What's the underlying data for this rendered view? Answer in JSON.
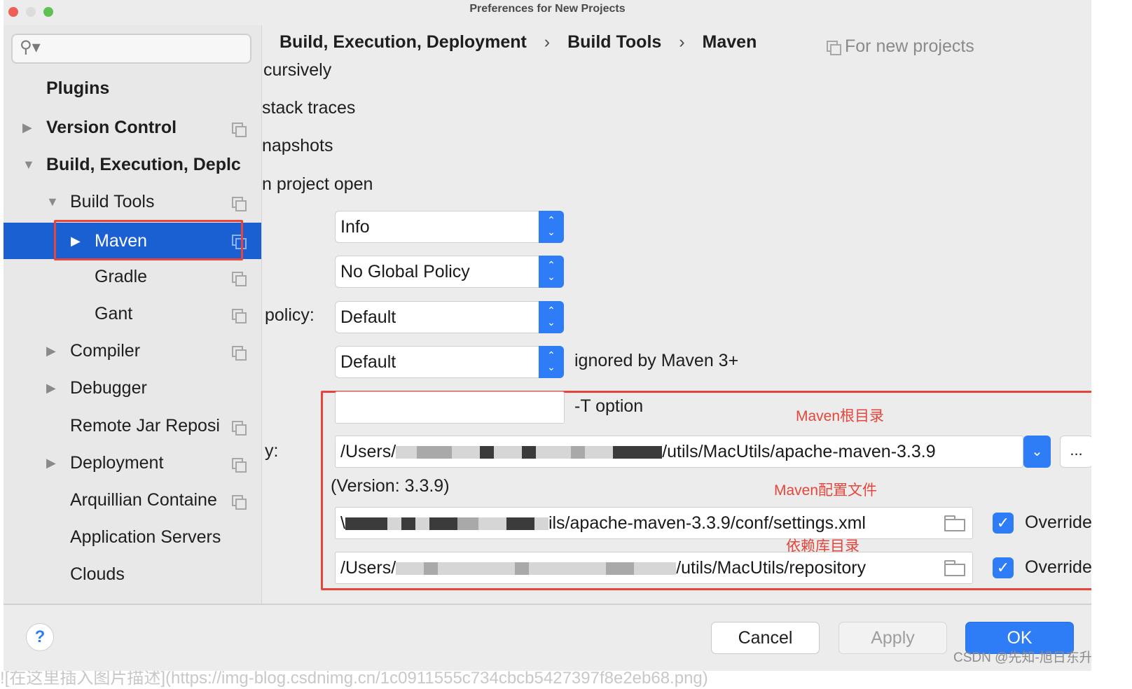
{
  "window": {
    "title": "Preferences for New Projects"
  },
  "search": {
    "placeholder": ""
  },
  "sidebar": {
    "items": [
      {
        "label": "Plugins"
      },
      {
        "label": "Version Control"
      },
      {
        "label": "Build, Execution, Deplc"
      },
      {
        "label": "Build Tools"
      },
      {
        "label": "Maven"
      },
      {
        "label": "Gradle"
      },
      {
        "label": "Gant"
      },
      {
        "label": "Compiler"
      },
      {
        "label": "Debugger"
      },
      {
        "label": "Remote Jar Reposi"
      },
      {
        "label": "Deployment"
      },
      {
        "label": "Arquillian Containe"
      },
      {
        "label": "Application Servers"
      },
      {
        "label": "Clouds"
      }
    ]
  },
  "breadcrumb": {
    "items": [
      "Build, Execution, Deployment",
      "Build Tools",
      "Maven"
    ],
    "separator": "›"
  },
  "for_new_projects": "For new projects",
  "partial_labels": {
    "recursively": "cursively",
    "stack_traces": "stack traces",
    "snapshots": "napshots",
    "project_open": "n project open",
    "policy": "policy:",
    "home_dir": "y:"
  },
  "settings": {
    "output_level": "Info",
    "checksum_policy": "No Global Policy",
    "multiproject_policy": "Default",
    "plugin_update_policy": "Default",
    "plugin_update_note": "ignored by Maven 3+",
    "threads_value": "",
    "threads_note": "-T option",
    "maven_home_suffix": "/utils/MacUtils/apache-maven-3.3.9",
    "maven_home_prefix": "/Users/",
    "version": "(Version: 3.3.9)",
    "settings_file_suffix": "ils/apache-maven-3.3.9/conf/settings.xml",
    "settings_file_prefix": "\\",
    "repository_prefix": "/Users/",
    "repository_suffix": "/utils/MacUtils/repository",
    "override_label": "Override",
    "browse_label": "..."
  },
  "annotations": {
    "maven_home": "Maven根目录",
    "maven_config": "Maven配置文件",
    "repository": "依赖库目录"
  },
  "buttons": {
    "help": "?",
    "cancel": "Cancel",
    "apply": "Apply",
    "ok": "OK"
  },
  "watermark": "CSDN @先知-旭日东升",
  "footer_caption": "![在这里插入图片描述](https://img-blog.csdnimg.cn/1c0911555c734cbcb5427397f8e2eb68.png)",
  "colors": {
    "accent": "#2e7cf6",
    "selection": "#1b60d3",
    "annotation": "#e4463b"
  }
}
